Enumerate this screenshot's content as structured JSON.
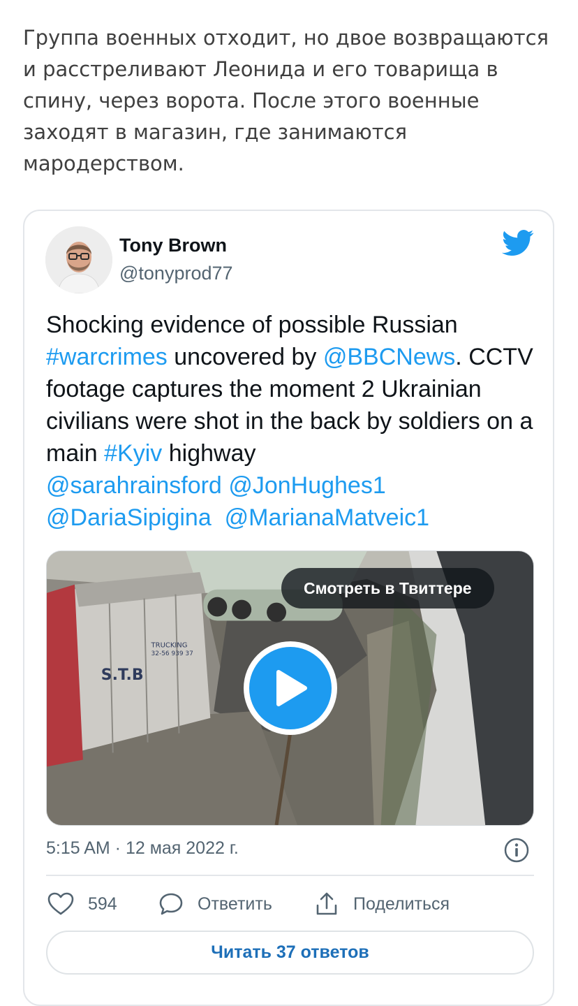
{
  "article": {
    "paragraph": "Группа военных отходит, но двое возвращаются и расстреливают Леонида и его товарища в спину, через ворота. После этого военные заходят в магазин, где занимаются мародерством."
  },
  "tweet": {
    "author_name": "Tony Brown",
    "author_handle": "@tonyprod77",
    "text_parts": {
      "p1": "Shocking evidence of possible Russian ",
      "hashtag_warcrimes": "#warcrimes",
      "p2": " uncovered by ",
      "mention_bbc": "@BBCNews",
      "p3": ". CCTV footage captures the moment 2 Ukrainian civilians were shot in the back by soldiers on a main ",
      "hashtag_kyiv": "#Kyiv",
      "p4": " highway",
      "mention_sarah": "@sarahrainsford",
      "mention_jon": "@JonHughes1",
      "mention_daria": "@DariaSipigina",
      "mention_mariana": "@MarianaMatveic1"
    },
    "media": {
      "watch_label": "Смотреть в Твиттере",
      "truck_text": "S.T.B",
      "truck_small_text": "TRUCKING",
      "truck_phone": "32-56 939 37"
    },
    "timestamp": "5:15 AM · 12 мая 2022 г.",
    "actions": {
      "like_count": "594",
      "reply_label": "Ответить",
      "share_label": "Поделиться"
    },
    "read_replies_label": "Читать 37 ответов"
  },
  "colors": {
    "link": "#1d9bf0",
    "text": "#0f1419",
    "muted": "#536471",
    "play_blue": "#1d9bf0"
  },
  "icons": [
    "twitter-bird-icon",
    "play-icon",
    "info-icon",
    "heart-icon",
    "reply-bubble-icon",
    "share-icon"
  ]
}
